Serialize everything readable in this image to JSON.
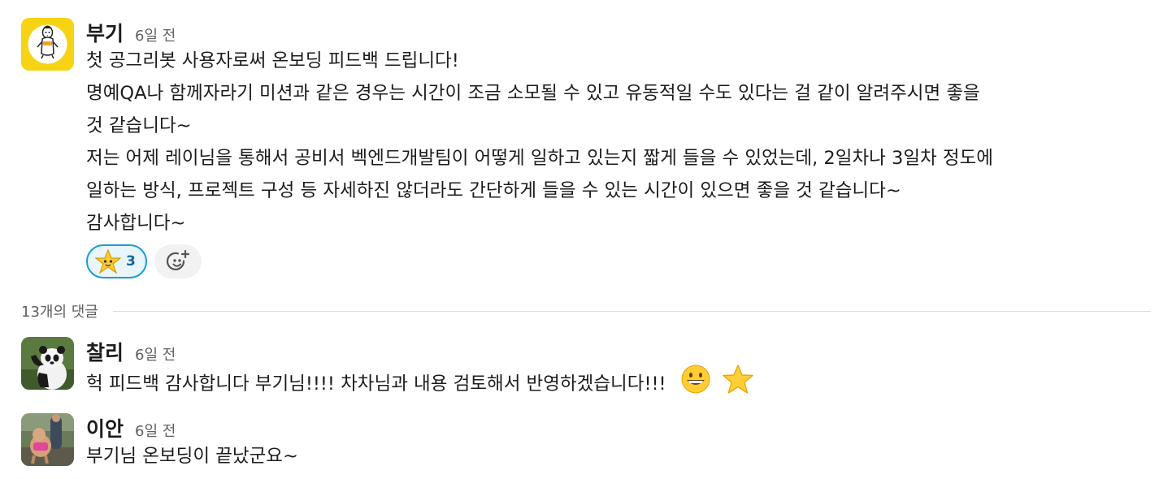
{
  "messages": [
    {
      "author": "부기",
      "time": "6일 전",
      "avatar": "boogi-penguin-avatar",
      "lines": [
        "첫 공그리봇 사용자로써 온보딩 피드백 드립니다!",
        "명예QA나 함께자라기 미션과 같은 경우는 시간이 조금 소모될 수 있고 유동적일 수도 있다는 걸 같이 알려주시면 좋을",
        "것 같습니다~",
        "저는 어제 레이님을 통해서 공비서 벡엔드개발팀이 어떻게 일하고 있는지 짧게 들을 수 있었는데, 2일차나 3일차 정도에",
        "일하는 방식, 프로젝트 구성 등 자세하진 않더라도 간단하게 들을 수 있는 시간이 있으면 좋을 것 같습니다~",
        "감사합니다~"
      ],
      "reactions": [
        {
          "emoji": "star-struck-icon",
          "count": "3"
        }
      ]
    },
    {
      "author": "찰리",
      "time": "6일 전",
      "avatar": "panda-avatar",
      "text": "헉 피드백 감사합니다 부기님!!!! 차차님과 내용 검토해서 반영하겠습니다!!!",
      "inline_emojis": [
        "grinning-face-icon",
        "star-icon"
      ]
    },
    {
      "author": "이안",
      "time": "6일 전",
      "avatar": "dog-photo-avatar",
      "text": "부기님 온보딩이 끝났군요~"
    }
  ],
  "replies_label": "13개의 댓글",
  "colors": {
    "reaction_border": "#1d9bd1",
    "reaction_bg": "#e8f5fa",
    "reaction_count": "#1264a3",
    "timestamp": "#616061"
  }
}
